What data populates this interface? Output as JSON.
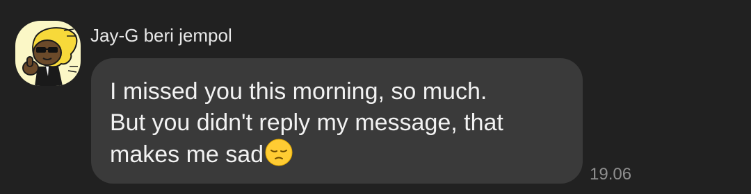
{
  "message": {
    "sender": "Jay-G beri jempol",
    "text": "I missed you this morning, so much.\nBut you didn't reply my message, that\nmakes me sad",
    "emoji": "pensive-face",
    "time": "19.06"
  },
  "colors": {
    "background": "#212121",
    "bubble": "#3a3a3a",
    "text": "#f2f2f2",
    "timestamp": "#8f8f8f",
    "avatar_bg": "#fbf7c6"
  }
}
